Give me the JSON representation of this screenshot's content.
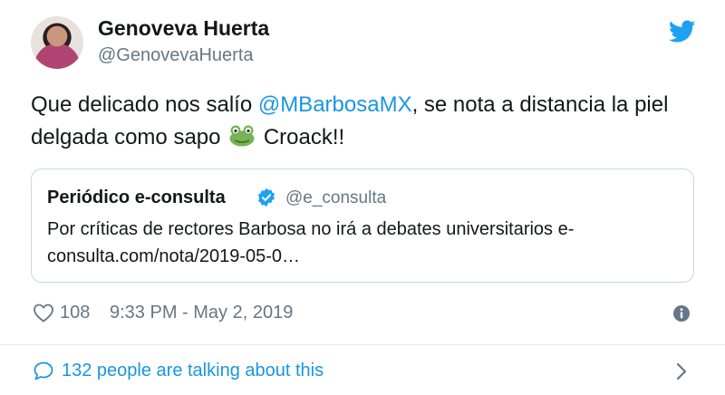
{
  "author": {
    "name": "Genoveva Huerta",
    "handle": "@GenovevaHuerta"
  },
  "tweet": {
    "text_before": "Que delicado nos salío ",
    "mention": "@MBarbosaMX",
    "text_after_mention": ", se nota a distancia la piel delgada como sapo",
    "emoji": "frog-face",
    "text_end": " Croack!!"
  },
  "quoted": {
    "name": "Periódico e-consulta",
    "handle": "@e_consulta",
    "text": "Por críticas de rectores Barbosa no irá a debates universitarios e-consulta.com/nota/2019-05-0…"
  },
  "meta": {
    "likes": "108",
    "timestamp": "9:33 PM - May 2, 2019"
  },
  "footer": {
    "talking": "132 people are talking about this"
  },
  "icons": {
    "bird": "twitter-bird-icon",
    "verified": "verified-badge-icon",
    "heart": "heart-icon",
    "info": "info-icon",
    "bubble": "speech-bubble-icon",
    "chevron": "chevron-right-icon"
  },
  "colors": {
    "accent": "#1b95e0",
    "muted": "#657786",
    "text": "#14171a",
    "border": "#ccd6dd"
  }
}
